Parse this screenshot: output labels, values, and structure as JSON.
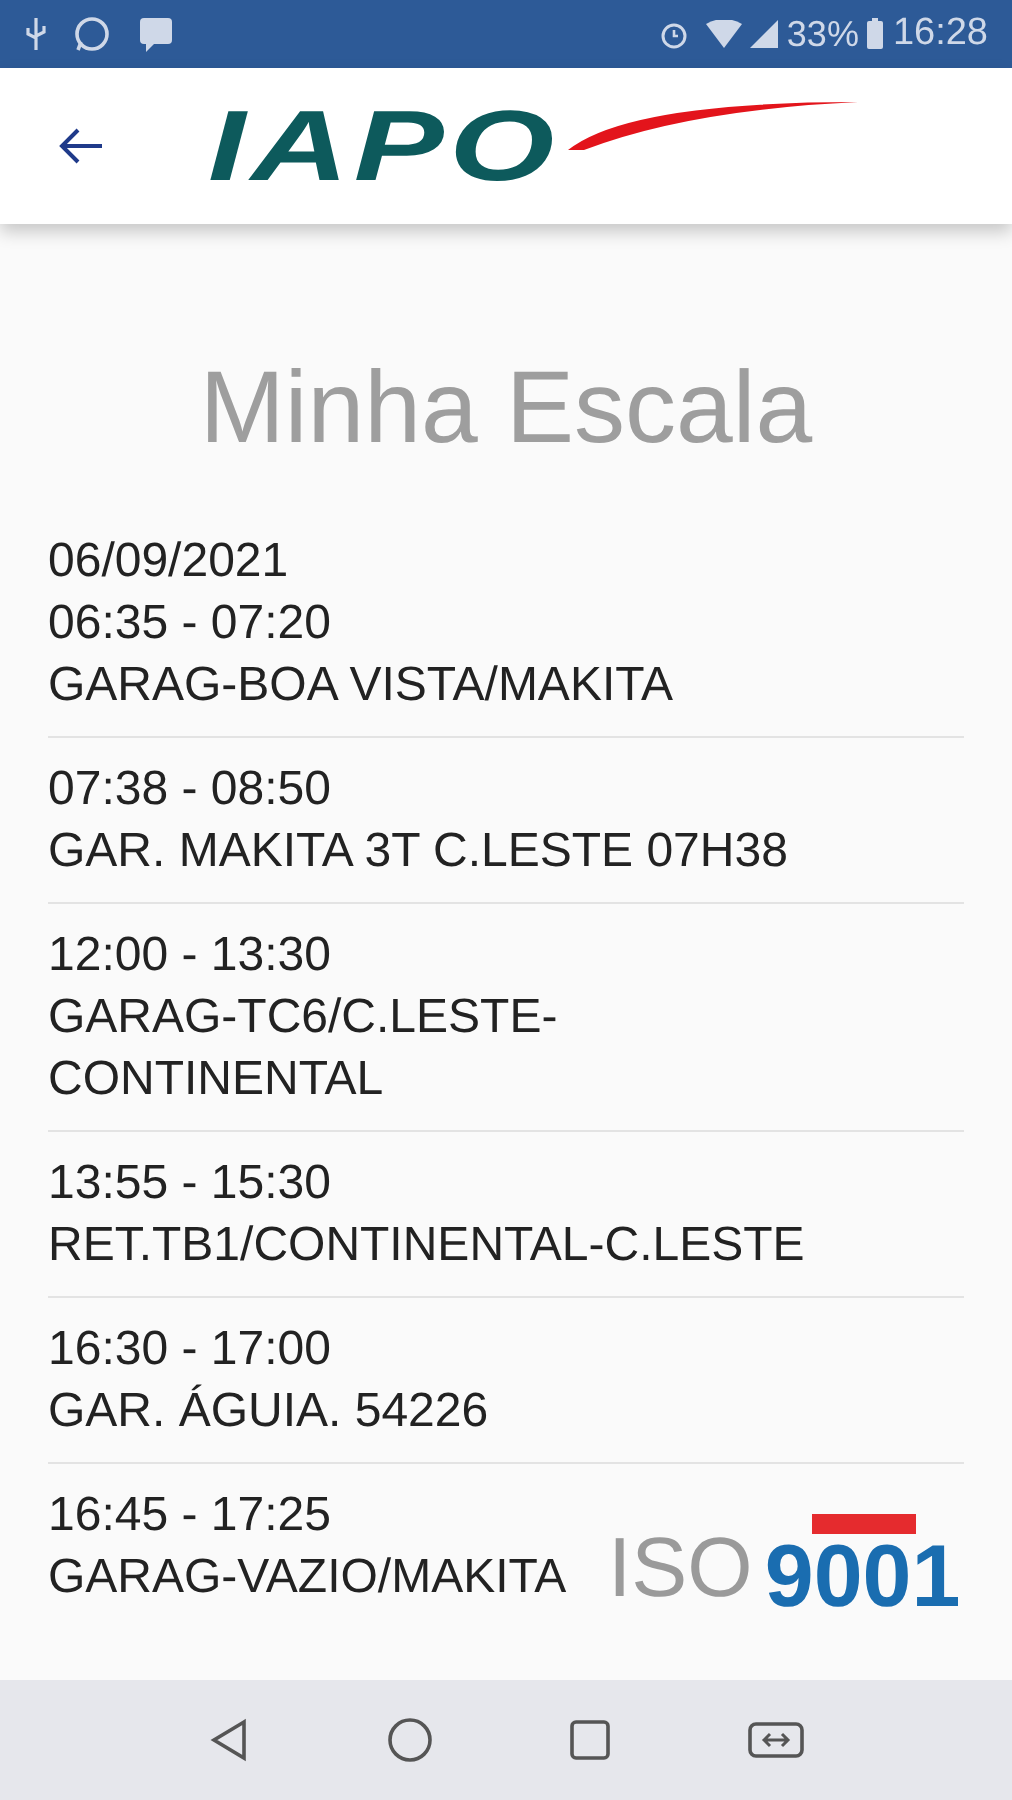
{
  "status_bar": {
    "battery": "33%",
    "time": "16:28"
  },
  "header": {
    "logo": "IAPO"
  },
  "title": "Minha Escala",
  "schedule": [
    {
      "lines": [
        "06/09/2021",
        "06:35 - 07:20",
        "GARAG-BOA VISTA/MAKITA"
      ]
    },
    {
      "lines": [
        "07:38 - 08:50",
        "GAR. MAKITA 3T C.LESTE 07H38"
      ]
    },
    {
      "lines": [
        "12:00 - 13:30",
        "GARAG-TC6/C.LESTE-",
        "CONTINENTAL"
      ]
    },
    {
      "lines": [
        "13:55 - 15:30",
        "RET.TB1/CONTINENTAL-C.LESTE"
      ]
    },
    {
      "lines": [
        "16:30 - 17:00",
        "GAR. ÁGUIA. 54226"
      ]
    },
    {
      "lines": [
        "16:45 - 17:25",
        "GARAG-VAZIO/MAKITA"
      ]
    }
  ],
  "iso_badge": {
    "prefix": "ISO",
    "number": "9001"
  }
}
